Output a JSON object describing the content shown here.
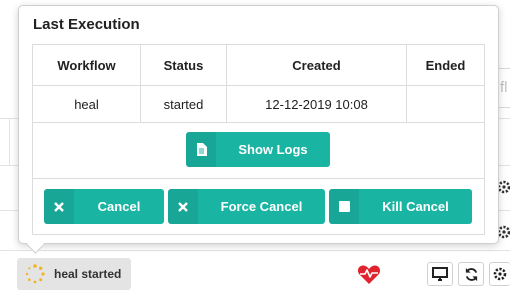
{
  "background": {
    "search_placeholder": "fl"
  },
  "popover": {
    "title": "Last Execution",
    "table": {
      "headers": [
        "Workflow",
        "Status",
        "Created",
        "Ended"
      ],
      "row": {
        "workflow": "heal",
        "status": "started",
        "created": "12-12-2019 10:08",
        "ended": ""
      }
    },
    "show_logs_label": "Show Logs",
    "cancel_label": "Cancel",
    "force_cancel_label": "Force Cancel",
    "kill_cancel_label": "Kill Cancel"
  },
  "status_bar": {
    "status_text": "heal started"
  },
  "icons": {
    "logs": "file-text-icon",
    "cancel": "x-icon",
    "force_cancel": "x-icon",
    "kill_cancel": "stop-square-icon",
    "spinner": "spinner-icon",
    "health": "heartbeat-icon",
    "desktop": "desktop-icon",
    "refresh": "refresh-icon",
    "settings": "gear-icon"
  },
  "colors": {
    "accent": "#1ab4a3",
    "heart": "#e0232e",
    "spinner": "#f2b51d"
  }
}
